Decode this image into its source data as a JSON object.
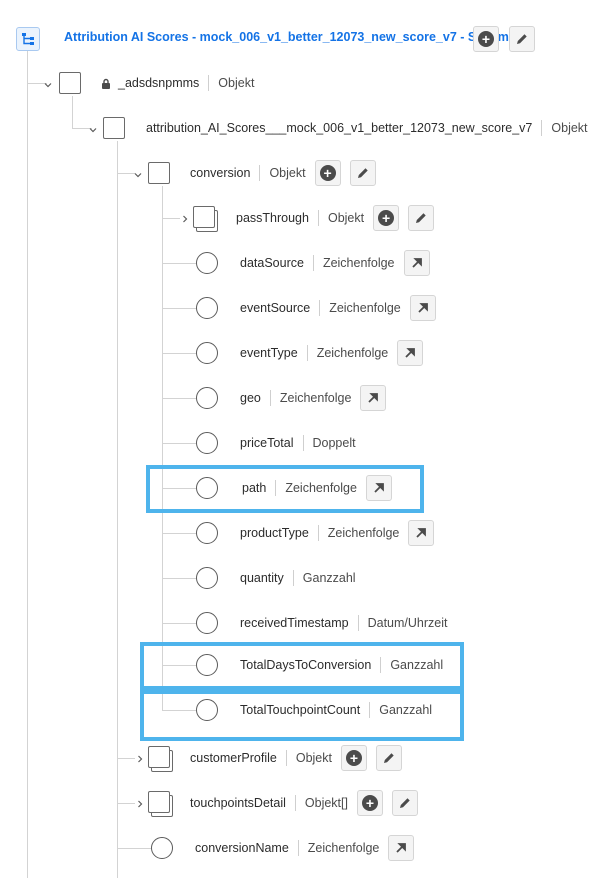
{
  "schema": {
    "title": "Attribution AI Scores - mock_006_v1_better_12073_new_score_v7 - Schema"
  },
  "nodes": {
    "adsdsnpmms": {
      "name": "_adsdsnpmms",
      "type": "Objekt"
    },
    "attribution": {
      "name": "attribution_AI_Scores___mock_006_v1_better_12073_new_score_v7",
      "type": "Objekt"
    },
    "conversion": {
      "name": "conversion",
      "type": "Objekt"
    },
    "passThrough": {
      "name": "passThrough",
      "type": "Objekt"
    },
    "dataSource": {
      "name": "dataSource",
      "type": "Zeichenfolge"
    },
    "eventSource": {
      "name": "eventSource",
      "type": "Zeichenfolge"
    },
    "eventType": {
      "name": "eventType",
      "type": "Zeichenfolge"
    },
    "geo": {
      "name": "geo",
      "type": "Zeichenfolge"
    },
    "priceTotal": {
      "name": "priceTotal",
      "type": "Doppelt"
    },
    "path": {
      "name": "path",
      "type": "Zeichenfolge"
    },
    "productType": {
      "name": "productType",
      "type": "Zeichenfolge"
    },
    "quantity": {
      "name": "quantity",
      "type": "Ganzzahl"
    },
    "receivedTimestamp": {
      "name": "receivedTimestamp",
      "type": "Datum/Uhrzeit"
    },
    "totalDays": {
      "name": "TotalDaysToConversion",
      "type": "Ganzzahl"
    },
    "totalTouchpoint": {
      "name": "TotalTouchpointCount",
      "type": "Ganzzahl"
    },
    "customerProfile": {
      "name": "customerProfile",
      "type": "Objekt"
    },
    "touchpointsDetail": {
      "name": "touchpointsDetail",
      "type": "Objekt[]"
    },
    "conversionName": {
      "name": "conversionName",
      "type": "Zeichenfolge"
    }
  },
  "icons": {
    "schema": "schema-icon",
    "lock": "lock-icon",
    "add": "add-icon",
    "edit": "edit-icon",
    "open": "open-in-icon",
    "chevron_down": "chevron-down-icon",
    "chevron_right": "chevron-right-icon"
  },
  "colors": {
    "accent": "#1473e6",
    "highlight": "#4eb4ec"
  }
}
